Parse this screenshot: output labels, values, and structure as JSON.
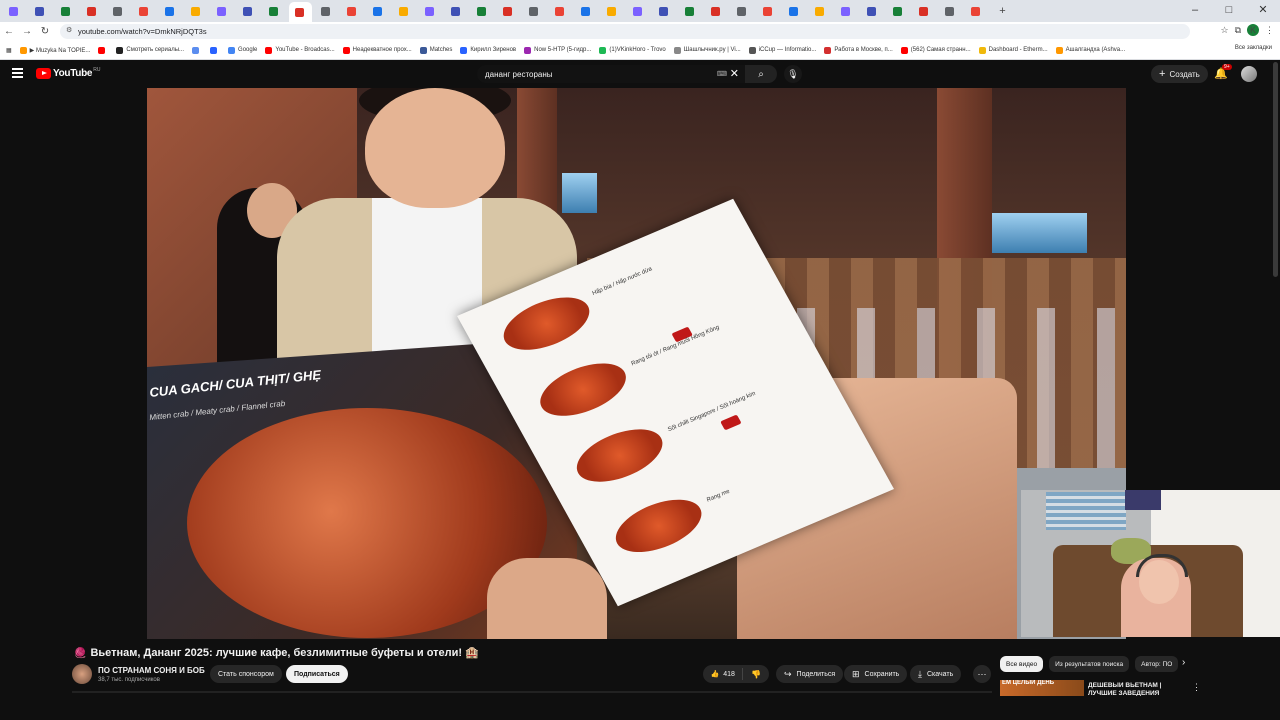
{
  "browser": {
    "tab_count": 38,
    "url": "youtube.com/watch?v=DmkNRjDQT3s",
    "bookmarks": [
      {
        "label": "▶ Muzyka Na TOPIE...",
        "color": "#ff9800"
      },
      {
        "label": "",
        "color": "#ff0000"
      },
      {
        "label": "Смотреть сериалы...",
        "color": "#222222"
      },
      {
        "label": "",
        "color": "#5b8def"
      },
      {
        "label": "",
        "color": "#2962ff"
      },
      {
        "label": "Google",
        "color": "#4285f4"
      },
      {
        "label": "YouTube - Broadcas...",
        "color": "#ff0000"
      },
      {
        "label": "Неадекватное прох...",
        "color": "#ff0000"
      },
      {
        "label": "Matches",
        "color": "#3b5998"
      },
      {
        "label": "Кирилл Зиренов",
        "color": "#2962ff"
      },
      {
        "label": "Now 5-HTP (5-гидр...",
        "color": "#9c27b0"
      },
      {
        "label": "(1)VKinkHoro - Trovo",
        "color": "#1db954"
      },
      {
        "label": "Шашлычник.ру | Vi...",
        "color": "#888888"
      },
      {
        "label": "iCCup — Informatio...",
        "color": "#555555"
      },
      {
        "label": "Работа в Москве, п...",
        "color": "#d32f2f"
      },
      {
        "label": "(562) Самая странн...",
        "color": "#ff0000"
      },
      {
        "label": "Dashboard - Etherm...",
        "color": "#f0b90b"
      },
      {
        "label": "Ашалгандха (Ashva...",
        "color": "#ff9800"
      }
    ],
    "all_bookmarks": "Все закладки",
    "profile_initial": "K"
  },
  "header": {
    "logo_text": "YouTube",
    "country_code": "RU",
    "search_value": "дананг рестораны",
    "create_label": "Создать",
    "notif_badge": "9+"
  },
  "video": {
    "menu_title": "CUA GACH/ CUA THỊT/ GHẸ",
    "menu_subtitle": "Mitten crab / Meaty crab / Flannel crab",
    "dishes": [
      {
        "label": "Hấp bia / Hấp nước dừa"
      },
      {
        "label": "Rang tỏi ớt / Rang muối Hồng Kông"
      },
      {
        "label": "Sốt chilli Singapore / Sốt hoàng kim"
      },
      {
        "label": "Rang me"
      }
    ]
  },
  "meta": {
    "title_emoji_left": "🧶",
    "title": "Вьетнам, Дананг 2025: лучшие кафе, безлимитные буфеты и отели!",
    "title_emoji_right": "🏨",
    "channel_name": "ПО СТРАНАМ СОНЯ И БОБ",
    "subscribers": "38,7 тыс. подписчиков",
    "sponsor_label": "Стать спонсором",
    "subscribe_label": "Подписаться",
    "likes": "418",
    "share_label": "Поделиться",
    "save_label": "Сохранить",
    "download_label": "Скачать"
  },
  "sidebar": {
    "chips": [
      "Все видео",
      "Из результатов поиска",
      "Автор: ПО"
    ],
    "rec_thumb_text": "ЕМ ЦЕЛЫЙ ДЕНЬ",
    "rec_title": "ДЕШЕВЫЙ ВЬЕТНАМ | ЛУЧШИЕ ЗАВЕДЕНИЯ"
  },
  "colors": {
    "youtube_red": "#ff0000",
    "page_bg": "#0f0f0f",
    "button_bg": "#272727"
  }
}
